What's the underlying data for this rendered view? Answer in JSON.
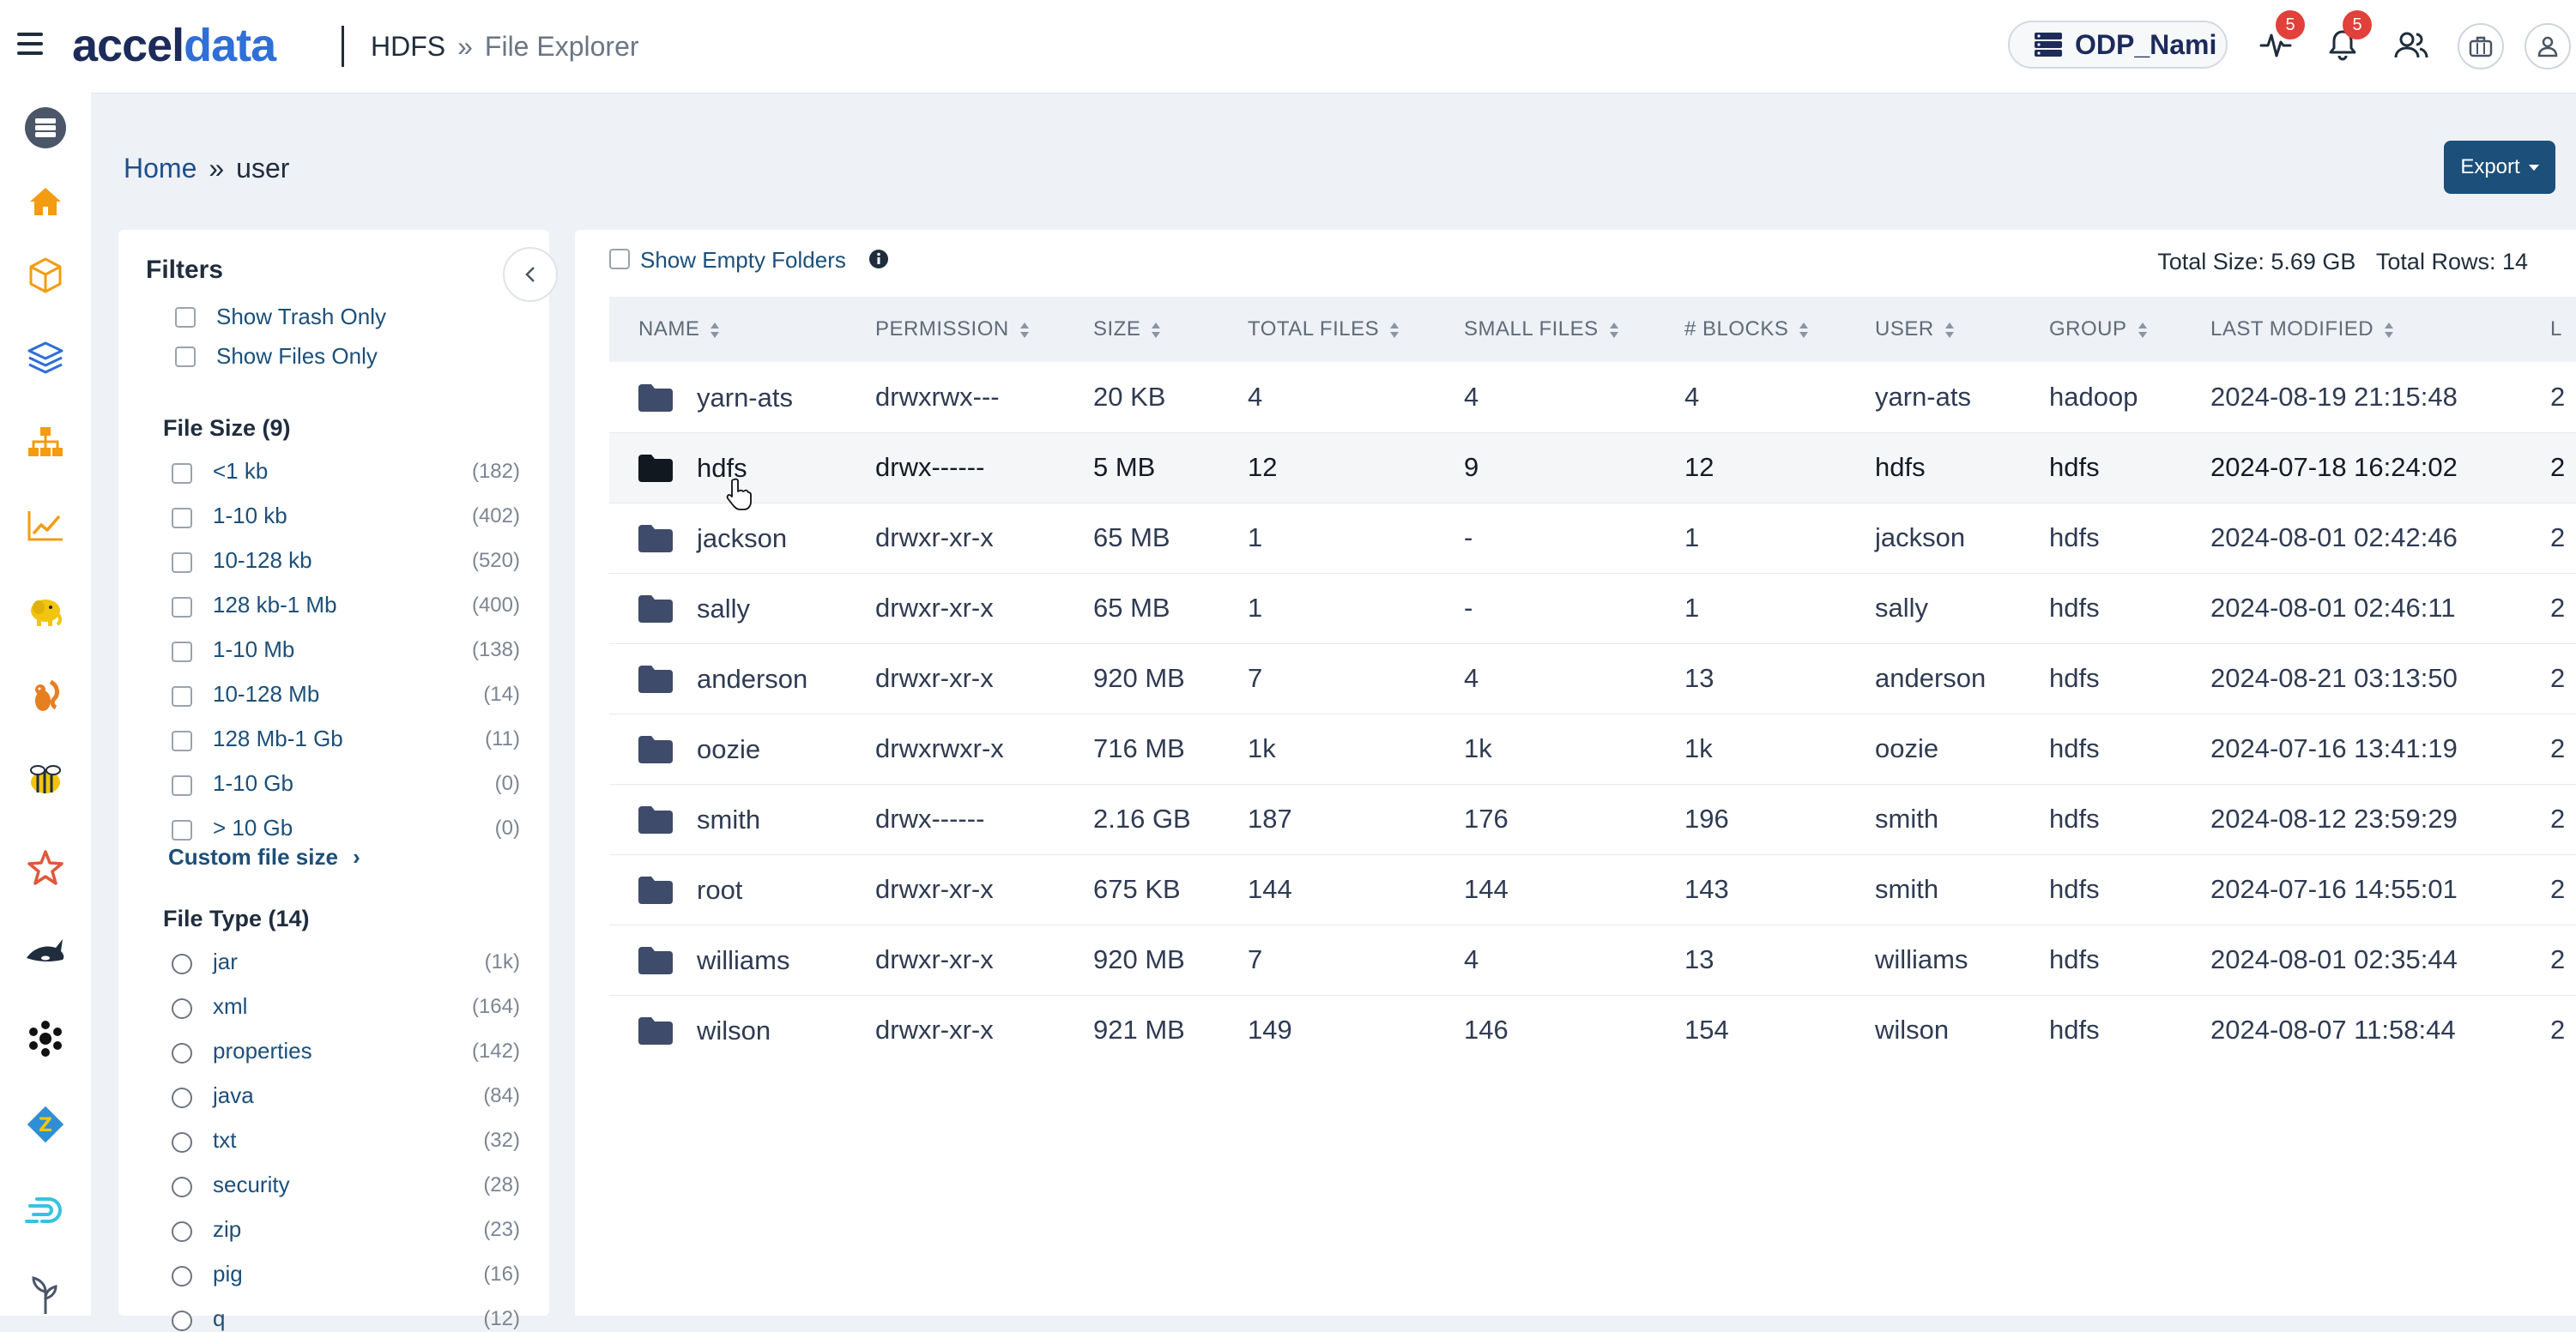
{
  "topbar": {
    "brand_left": "accel",
    "brand_right": "data",
    "section": "HDFS",
    "separator": "»",
    "page": "File Explorer",
    "cluster": "ODP_Nami",
    "health_badge": "5",
    "notifications_badge": "5"
  },
  "breadcrumb": {
    "home": "Home",
    "separator": "»",
    "current": "user"
  },
  "export_label": "Export",
  "filters": {
    "title": "Filters",
    "options": [
      {
        "label": "Show Trash Only"
      },
      {
        "label": "Show Files Only"
      }
    ],
    "file_size": {
      "heading": "File Size (9)",
      "items": [
        {
          "label": "<1 kb",
          "count": "(182)"
        },
        {
          "label": "1-10 kb",
          "count": "(402)"
        },
        {
          "label": "10-128 kb",
          "count": "(520)"
        },
        {
          "label": "128 kb-1 Mb",
          "count": "(400)"
        },
        {
          "label": "1-10 Mb",
          "count": "(138)"
        },
        {
          "label": "10-128 Mb",
          "count": "(14)"
        },
        {
          "label": "128 Mb-1 Gb",
          "count": "(11)"
        },
        {
          "label": "1-10 Gb",
          "count": "(0)"
        },
        {
          "label": "> 10 Gb",
          "count": "(0)"
        }
      ],
      "custom_link": "Custom file size",
      "custom_chevron": "›"
    },
    "file_type": {
      "heading": "File Type (14)",
      "items": [
        {
          "label": "jar",
          "count": "(1k)"
        },
        {
          "label": "xml",
          "count": "(164)"
        },
        {
          "label": "properties",
          "count": "(142)"
        },
        {
          "label": "java",
          "count": "(84)"
        },
        {
          "label": "txt",
          "count": "(32)"
        },
        {
          "label": "security",
          "count": "(28)"
        },
        {
          "label": "zip",
          "count": "(23)"
        },
        {
          "label": "pig",
          "count": "(16)"
        },
        {
          "label": "q",
          "count": "(12)"
        }
      ]
    }
  },
  "main": {
    "show_empty_label": "Show Empty Folders",
    "total_size": "Total Size: 5.69 GB",
    "total_rows": "Total Rows: 14",
    "columns": [
      "NAME",
      "PERMISSION",
      "SIZE",
      "TOTAL FILES",
      "SMALL FILES",
      "# BLOCKS",
      "USER",
      "GROUP",
      "LAST MODIFIED",
      "L"
    ],
    "rows": [
      {
        "name": "yarn-ats",
        "permission": "drwxrwx---",
        "size": "20 KB",
        "total_files": "4",
        "small_files": "4",
        "blocks": "4",
        "user": "yarn-ats",
        "group": "hadoop",
        "last_modified": "2024-08-19 21:15:48",
        "extra": "2"
      },
      {
        "name": "hdfs",
        "permission": "drwx------",
        "size": "5 MB",
        "total_files": "12",
        "small_files": "9",
        "blocks": "12",
        "user": "hdfs",
        "group": "hdfs",
        "last_modified": "2024-07-18 16:24:02",
        "extra": "2"
      },
      {
        "name": "jackson",
        "permission": "drwxr-xr-x",
        "size": "65 MB",
        "total_files": "1",
        "small_files": "-",
        "blocks": "1",
        "user": "jackson",
        "group": "hdfs",
        "last_modified": "2024-08-01 02:42:46",
        "extra": "2"
      },
      {
        "name": "sally",
        "permission": "drwxr-xr-x",
        "size": "65 MB",
        "total_files": "1",
        "small_files": "-",
        "blocks": "1",
        "user": "sally",
        "group": "hdfs",
        "last_modified": "2024-08-01 02:46:11",
        "extra": "2"
      },
      {
        "name": "anderson",
        "permission": "drwxr-xr-x",
        "size": "920 MB",
        "total_files": "7",
        "small_files": "4",
        "blocks": "13",
        "user": "anderson",
        "group": "hdfs",
        "last_modified": "2024-08-21 03:13:50",
        "extra": "2"
      },
      {
        "name": "oozie",
        "permission": "drwxrwxr-x",
        "size": "716 MB",
        "total_files": "1k",
        "small_files": "1k",
        "blocks": "1k",
        "user": "oozie",
        "group": "hdfs",
        "last_modified": "2024-07-16 13:41:19",
        "extra": "2"
      },
      {
        "name": "smith",
        "permission": "drwx------",
        "size": "2.16 GB",
        "total_files": "187",
        "small_files": "176",
        "blocks": "196",
        "user": "smith",
        "group": "hdfs",
        "last_modified": "2024-08-12 23:59:29",
        "extra": "2"
      },
      {
        "name": "root",
        "permission": "drwxr-xr-x",
        "size": "675 KB",
        "total_files": "144",
        "small_files": "144",
        "blocks": "143",
        "user": "smith",
        "group": "hdfs",
        "last_modified": "2024-07-16 14:55:01",
        "extra": "2"
      },
      {
        "name": "williams",
        "permission": "drwxr-xr-x",
        "size": "920 MB",
        "total_files": "7",
        "small_files": "4",
        "blocks": "13",
        "user": "williams",
        "group": "hdfs",
        "last_modified": "2024-08-01 02:35:44",
        "extra": "2"
      },
      {
        "name": "wilson",
        "permission": "drwxr-xr-x",
        "size": "921 MB",
        "total_files": "149",
        "small_files": "146",
        "blocks": "154",
        "user": "wilson",
        "group": "hdfs",
        "last_modified": "2024-08-07 11:58:44",
        "extra": "2"
      }
    ]
  }
}
